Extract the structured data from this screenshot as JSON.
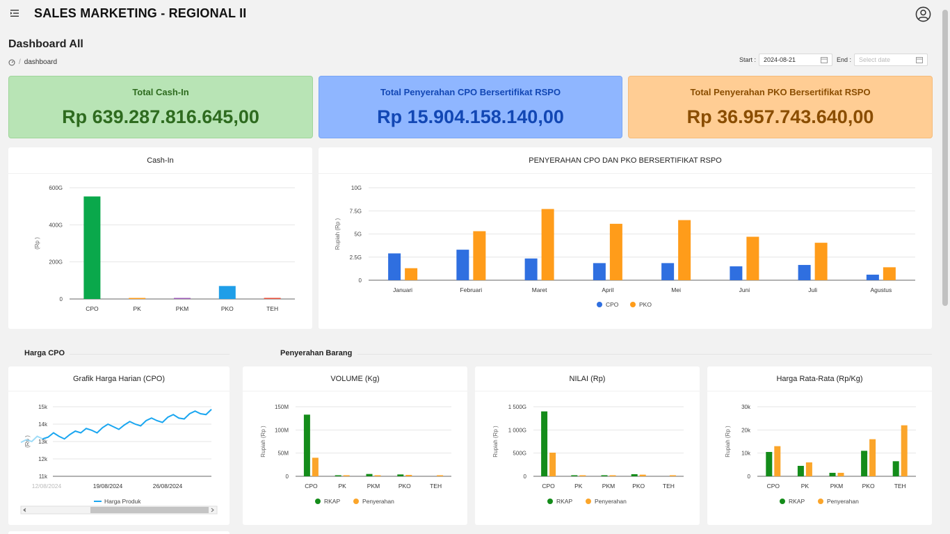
{
  "app": {
    "title": "SALES MARKETING - REGIONAL II"
  },
  "page": {
    "title": "Dashboard All",
    "breadcrumb": "dashboard"
  },
  "filters": {
    "start_label": "Start :",
    "start_value": "2024-08-21",
    "end_label": "End :",
    "end_placeholder": "Select date"
  },
  "stats": [
    {
      "label": "Total Cash-In",
      "value": "Rp 639.287.816.645,00"
    },
    {
      "label": "Total Penyerahan CPO Bersertifikat RSPO",
      "value": "Rp 15.904.158.140,00"
    },
    {
      "label": "Total Penyerahan PKO Bersertifikat RSPO",
      "value": "Rp 36.957.743.640,00"
    }
  ],
  "colors": {
    "green": "#0aa84b",
    "orange": "#ff9c1a",
    "blue": "#2f6fe0",
    "purple": "#9b59b6",
    "lightblue": "#1f9ee8",
    "red": "#e8533f",
    "rkap": "#148c1a",
    "penyerahan": "#fba52a",
    "line": "#1aa6f0"
  },
  "sections": {
    "harga": "Harga CPO",
    "penyerahan": "Penyerahan Barang"
  },
  "chart_data": [
    {
      "id": "cashin",
      "type": "bar",
      "title": "Cash-In",
      "ylabel": "(Rp )",
      "yticks": [
        "0",
        "200G",
        "400G",
        "600G"
      ],
      "ylim": [
        0,
        600
      ],
      "categories": [
        "CPO",
        "PK",
        "PKM",
        "PKO",
        "TEH"
      ],
      "values": [
        553,
        1,
        1,
        70,
        6
      ],
      "colors": [
        "#0aa84b",
        "#ff9c1a",
        "#9b59b6",
        "#1f9ee8",
        "#e8533f"
      ]
    },
    {
      "id": "rspo",
      "type": "bar",
      "title": "PENYERAHAN CPO DAN PKO BERSERTIFIKAT RSPO",
      "ylabel": "Rupiah (Rp )",
      "yticks": [
        "0",
        "2.5G",
        "5G",
        "7.5G",
        "10G"
      ],
      "ylim": [
        0,
        10
      ],
      "categories": [
        "Januari",
        "Februari",
        "Maret",
        "April",
        "Mei",
        "Juni",
        "Juli",
        "Agustus"
      ],
      "series": [
        {
          "name": "CPO",
          "values": [
            2.9,
            3.3,
            2.35,
            1.85,
            1.85,
            1.5,
            1.65,
            0.6
          ]
        },
        {
          "name": "PKO",
          "values": [
            1.3,
            5.3,
            7.7,
            6.1,
            6.5,
            4.7,
            4.05,
            1.4
          ]
        }
      ]
    },
    {
      "id": "harga",
      "type": "line",
      "title": "Grafik Harga Harian (CPO)",
      "ylabel": "(Rp )",
      "yticks": [
        "11k",
        "12k",
        "13k",
        "14k",
        "15k"
      ],
      "ylim": [
        11000,
        15000
      ],
      "xticks": [
        "12/08/2024",
        "19/08/2024",
        "26/08/2024"
      ],
      "series": [
        {
          "name": "Harga Produk",
          "values": [
            12950,
            13100,
            13000,
            13300,
            13150,
            13250,
            13500,
            13300,
            13150,
            13400,
            13600,
            13500,
            13750,
            13650,
            13500,
            13800,
            14000,
            13850,
            13700,
            13950,
            14150,
            14000,
            13900,
            14200,
            14350,
            14200,
            14100,
            14400,
            14550,
            14350,
            14300,
            14600,
            14750,
            14600,
            14550,
            14850
          ]
        }
      ]
    },
    {
      "id": "volume",
      "type": "bar",
      "title": "VOLUME (Kg)",
      "ylabel": "Rupiah (Rp )",
      "yticks": [
        "0",
        "50M",
        "100M",
        "150M"
      ],
      "ylim": [
        0,
        150
      ],
      "categories": [
        "CPO",
        "PK",
        "PKM",
        "PKO",
        "TEH"
      ],
      "series": [
        {
          "name": "RKAP",
          "values": [
            133,
            2,
            5,
            4,
            0
          ]
        },
        {
          "name": "Penyerahan",
          "values": [
            40,
            1,
            2,
            3,
            0.5
          ]
        }
      ]
    },
    {
      "id": "nilai",
      "type": "bar",
      "title": "NILAI (Rp)",
      "ylabel": "Rupiah (Rp )",
      "yticks": [
        "0",
        "500G",
        "1 000G",
        "1 500G"
      ],
      "ylim": [
        0,
        1500
      ],
      "categories": [
        "CPO",
        "PK",
        "PKM",
        "PKO",
        "TEH"
      ],
      "series": [
        {
          "name": "RKAP",
          "values": [
            1400,
            10,
            15,
            45,
            0
          ]
        },
        {
          "name": "Penyerahan",
          "values": [
            510,
            5,
            5,
            35,
            5
          ]
        }
      ]
    },
    {
      "id": "rata",
      "type": "bar",
      "title": "Harga Rata-Rata (Rp/Kg)",
      "ylabel": "Rupiah (Rp )",
      "yticks": [
        "0",
        "10k",
        "20k",
        "30k"
      ],
      "ylim": [
        0,
        30
      ],
      "categories": [
        "CPO",
        "PK",
        "PKM",
        "PKO",
        "TEH"
      ],
      "series": [
        {
          "name": "RKAP",
          "values": [
            10.5,
            4.5,
            1.5,
            11,
            6.5
          ]
        },
        {
          "name": "Penyerahan",
          "values": [
            13,
            6,
            1.5,
            16,
            22
          ]
        }
      ]
    }
  ]
}
